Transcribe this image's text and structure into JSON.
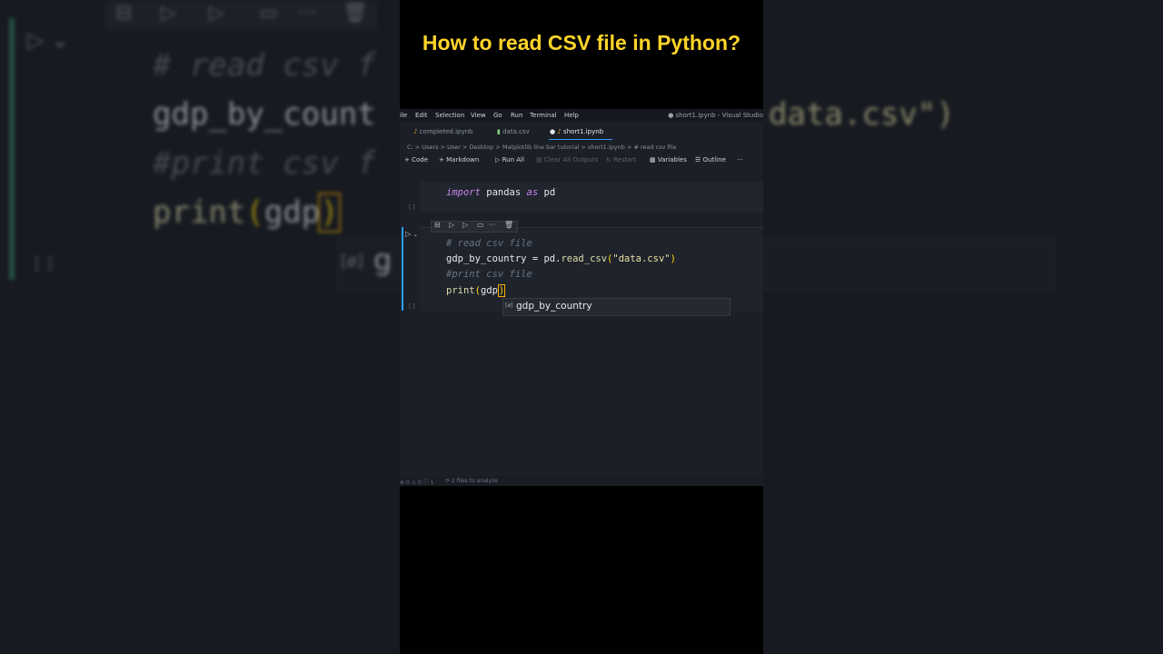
{
  "title": "How to read CSV file in Python?",
  "menu": {
    "items": [
      "ile",
      "Edit",
      "Selection",
      "View",
      "Go",
      "Run",
      "Terminal",
      "Help"
    ],
    "window_title": "● short1.ipynb - Visual Studio"
  },
  "tabs": [
    {
      "label": "completed.ipynb",
      "icon": "python-notebook-icon"
    },
    {
      "label": "data.csv",
      "icon": "csv-file-icon"
    },
    {
      "label": "short1.ipynb",
      "icon": "python-notebook-icon",
      "active": true,
      "modified": true
    }
  ],
  "breadcrumb": "C: > Users > User > Desktop > Matplotlib line bar tutorial > short1.ipynb > # read csv file",
  "toolbar": {
    "code": "Code",
    "markdown": "Markdown",
    "run_all": "Run All",
    "clear_outputs": "Clear All Outputs",
    "restart": "Restart",
    "variables": "Variables",
    "outline": "Outline",
    "more": "···"
  },
  "cells": {
    "cell1_bracket": "[ ]",
    "cell2_bracket": "[ ]",
    "cell1": {
      "kw1": "import",
      "mod": " pandas ",
      "kw2": "as",
      "alias": " pd"
    },
    "cell2": {
      "line1": "# read csv file",
      "line2_var": "gdp_by_country",
      "line2_eq": " = ",
      "line2_obj": "pd",
      "line2_dot": ".",
      "line2_fn": "read_csv",
      "line2_open": "(",
      "line2_str": "\"data.csv\"",
      "line2_close": ")",
      "line3": "#print csv file",
      "line4_fn": "print",
      "line4_open": "(",
      "line4_arg": "gdp",
      "line4_close": ")"
    }
  },
  "suggestion": {
    "icon": "[ø]",
    "text": "gdp_by_country"
  },
  "status": {
    "problems": "⊗ 0 ⚠ 0 ⓘ 1",
    "analyze": "⟳ 2 files to analyze"
  },
  "background": {
    "line1": "# read csv f",
    "line2": "gdp_by_count",
    "line2_right": "data.csv\")",
    "line3": "#print csv f",
    "line4a": "print",
    "line4b": "(",
    "line4c": "gdp",
    "line4d": ")",
    "suggest_icon": "[ø]",
    "suggest_text": "g",
    "bracket": "[ ]"
  },
  "colors": {
    "title": "#ffd429",
    "accent": "#2aa1ff",
    "keyword": "#c586f0",
    "function": "#dcdcaa",
    "comment": "#6b7381"
  }
}
